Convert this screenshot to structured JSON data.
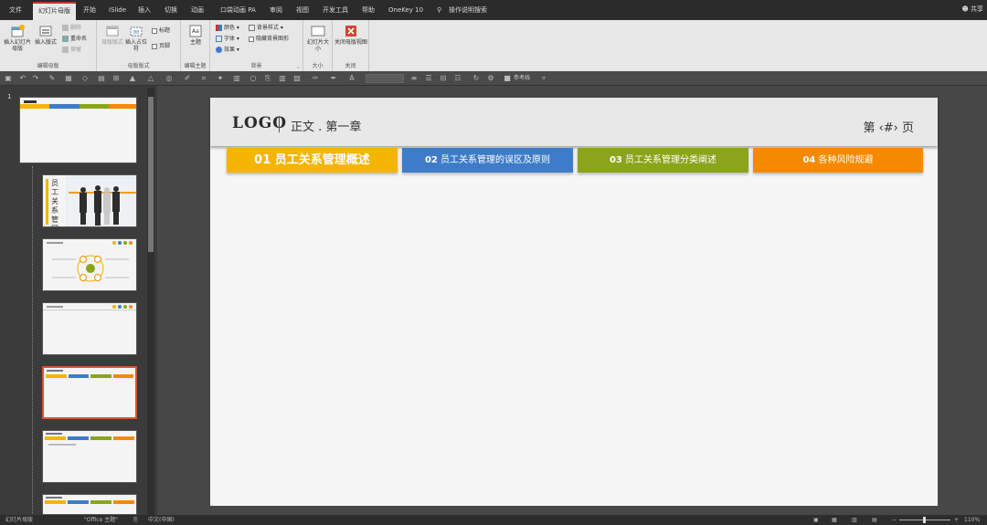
{
  "menu": {
    "tabs": [
      "文件",
      "幻灯片母版",
      "开始",
      "iSlide",
      "插入",
      "切换",
      "动画",
      "口袋动画 PA",
      "审阅",
      "视图",
      "开发工具",
      "帮助",
      "OneKey 10",
      "操作说明搜索"
    ],
    "active_index": 1,
    "share": "共享"
  },
  "ribbon": {
    "groups": [
      {
        "label": "编辑母版",
        "buttons": [
          "插入幻灯片母版",
          "插入版式",
          "删除",
          "重命名",
          "保留"
        ]
      },
      {
        "label": "母版版式",
        "buttons": [
          "母版版式",
          "插入占位符",
          "标题",
          "页脚"
        ]
      },
      {
        "label": "编辑主题",
        "buttons": [
          "主题"
        ]
      },
      {
        "label": "背景",
        "buttons": [
          "颜色",
          "字体",
          "效果",
          "背景样式",
          "隐藏背景图形"
        ]
      },
      {
        "label": "大小",
        "buttons": [
          "幻灯片大小"
        ]
      },
      {
        "label": "关闭",
        "buttons": [
          "关闭母版视图"
        ]
      }
    ]
  },
  "qat": {
    "reference_line": "参考线"
  },
  "thumbnails": {
    "first_number": "1",
    "count": 7,
    "selected_index": 4,
    "photo_title": "员工关系管理"
  },
  "slide": {
    "logo": "LOGO",
    "header_title": "正文 . 第一章",
    "page_number": "第 ‹#› 页",
    "tabs": [
      {
        "num": "01",
        "label": "员工关系管理概述",
        "color": "#f5b400"
      },
      {
        "num": "02",
        "label": "员工关系管理的误区及原则",
        "color": "#3d7cc9"
      },
      {
        "num": "03",
        "label": "员工关系管理分类阐述",
        "color": "#8aa51a"
      },
      {
        "num": "04",
        "label": "各种风险规避",
        "color": "#f58a00"
      }
    ]
  },
  "statusbar": {
    "view": "幻灯片母版",
    "theme": "\"Office 主题\"",
    "language": "中文(中国)",
    "zoom": "110%"
  }
}
